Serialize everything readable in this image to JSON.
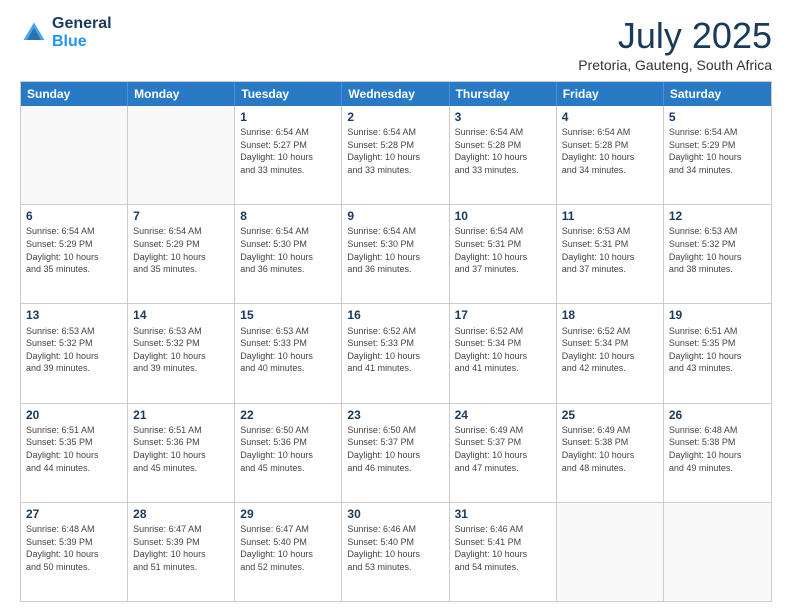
{
  "header": {
    "logo_line1": "General",
    "logo_line2": "Blue",
    "month": "July 2025",
    "location": "Pretoria, Gauteng, South Africa"
  },
  "days_of_week": [
    "Sunday",
    "Monday",
    "Tuesday",
    "Wednesday",
    "Thursday",
    "Friday",
    "Saturday"
  ],
  "weeks": [
    [
      {
        "num": "",
        "info": ""
      },
      {
        "num": "",
        "info": ""
      },
      {
        "num": "1",
        "info": "Sunrise: 6:54 AM\nSunset: 5:27 PM\nDaylight: 10 hours\nand 33 minutes."
      },
      {
        "num": "2",
        "info": "Sunrise: 6:54 AM\nSunset: 5:28 PM\nDaylight: 10 hours\nand 33 minutes."
      },
      {
        "num": "3",
        "info": "Sunrise: 6:54 AM\nSunset: 5:28 PM\nDaylight: 10 hours\nand 33 minutes."
      },
      {
        "num": "4",
        "info": "Sunrise: 6:54 AM\nSunset: 5:28 PM\nDaylight: 10 hours\nand 34 minutes."
      },
      {
        "num": "5",
        "info": "Sunrise: 6:54 AM\nSunset: 5:29 PM\nDaylight: 10 hours\nand 34 minutes."
      }
    ],
    [
      {
        "num": "6",
        "info": "Sunrise: 6:54 AM\nSunset: 5:29 PM\nDaylight: 10 hours\nand 35 minutes."
      },
      {
        "num": "7",
        "info": "Sunrise: 6:54 AM\nSunset: 5:29 PM\nDaylight: 10 hours\nand 35 minutes."
      },
      {
        "num": "8",
        "info": "Sunrise: 6:54 AM\nSunset: 5:30 PM\nDaylight: 10 hours\nand 36 minutes."
      },
      {
        "num": "9",
        "info": "Sunrise: 6:54 AM\nSunset: 5:30 PM\nDaylight: 10 hours\nand 36 minutes."
      },
      {
        "num": "10",
        "info": "Sunrise: 6:54 AM\nSunset: 5:31 PM\nDaylight: 10 hours\nand 37 minutes."
      },
      {
        "num": "11",
        "info": "Sunrise: 6:53 AM\nSunset: 5:31 PM\nDaylight: 10 hours\nand 37 minutes."
      },
      {
        "num": "12",
        "info": "Sunrise: 6:53 AM\nSunset: 5:32 PM\nDaylight: 10 hours\nand 38 minutes."
      }
    ],
    [
      {
        "num": "13",
        "info": "Sunrise: 6:53 AM\nSunset: 5:32 PM\nDaylight: 10 hours\nand 39 minutes."
      },
      {
        "num": "14",
        "info": "Sunrise: 6:53 AM\nSunset: 5:32 PM\nDaylight: 10 hours\nand 39 minutes."
      },
      {
        "num": "15",
        "info": "Sunrise: 6:53 AM\nSunset: 5:33 PM\nDaylight: 10 hours\nand 40 minutes."
      },
      {
        "num": "16",
        "info": "Sunrise: 6:52 AM\nSunset: 5:33 PM\nDaylight: 10 hours\nand 41 minutes."
      },
      {
        "num": "17",
        "info": "Sunrise: 6:52 AM\nSunset: 5:34 PM\nDaylight: 10 hours\nand 41 minutes."
      },
      {
        "num": "18",
        "info": "Sunrise: 6:52 AM\nSunset: 5:34 PM\nDaylight: 10 hours\nand 42 minutes."
      },
      {
        "num": "19",
        "info": "Sunrise: 6:51 AM\nSunset: 5:35 PM\nDaylight: 10 hours\nand 43 minutes."
      }
    ],
    [
      {
        "num": "20",
        "info": "Sunrise: 6:51 AM\nSunset: 5:35 PM\nDaylight: 10 hours\nand 44 minutes."
      },
      {
        "num": "21",
        "info": "Sunrise: 6:51 AM\nSunset: 5:36 PM\nDaylight: 10 hours\nand 45 minutes."
      },
      {
        "num": "22",
        "info": "Sunrise: 6:50 AM\nSunset: 5:36 PM\nDaylight: 10 hours\nand 45 minutes."
      },
      {
        "num": "23",
        "info": "Sunrise: 6:50 AM\nSunset: 5:37 PM\nDaylight: 10 hours\nand 46 minutes."
      },
      {
        "num": "24",
        "info": "Sunrise: 6:49 AM\nSunset: 5:37 PM\nDaylight: 10 hours\nand 47 minutes."
      },
      {
        "num": "25",
        "info": "Sunrise: 6:49 AM\nSunset: 5:38 PM\nDaylight: 10 hours\nand 48 minutes."
      },
      {
        "num": "26",
        "info": "Sunrise: 6:48 AM\nSunset: 5:38 PM\nDaylight: 10 hours\nand 49 minutes."
      }
    ],
    [
      {
        "num": "27",
        "info": "Sunrise: 6:48 AM\nSunset: 5:39 PM\nDaylight: 10 hours\nand 50 minutes."
      },
      {
        "num": "28",
        "info": "Sunrise: 6:47 AM\nSunset: 5:39 PM\nDaylight: 10 hours\nand 51 minutes."
      },
      {
        "num": "29",
        "info": "Sunrise: 6:47 AM\nSunset: 5:40 PM\nDaylight: 10 hours\nand 52 minutes."
      },
      {
        "num": "30",
        "info": "Sunrise: 6:46 AM\nSunset: 5:40 PM\nDaylight: 10 hours\nand 53 minutes."
      },
      {
        "num": "31",
        "info": "Sunrise: 6:46 AM\nSunset: 5:41 PM\nDaylight: 10 hours\nand 54 minutes."
      },
      {
        "num": "",
        "info": ""
      },
      {
        "num": "",
        "info": ""
      }
    ]
  ]
}
